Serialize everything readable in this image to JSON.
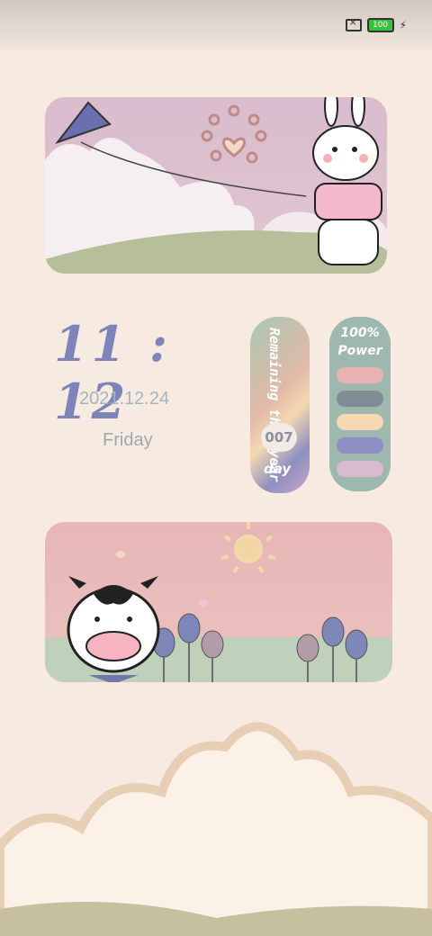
{
  "status_bar": {
    "battery_level": "100",
    "charging": true,
    "sim_icon": "no-sim-icon",
    "battery_color": "#39c13b"
  },
  "clock_widget": {
    "time": "11 : 12",
    "date": "2021.12.24",
    "weekday": "Friday",
    "time_color": "#7e84b9"
  },
  "remaining_widget": {
    "label": "Remaining this year",
    "count": "007",
    "unit": "day"
  },
  "power_widget": {
    "label": "100% Power",
    "bar_colors": [
      "#e8b3b3",
      "#7f8c96",
      "#f6d8b3",
      "#8e8fc2",
      "#d8bccd"
    ]
  },
  "illustrations": {
    "top_card": "bunny-flying-kite",
    "bottom_card": "cow-with-tulips"
  }
}
